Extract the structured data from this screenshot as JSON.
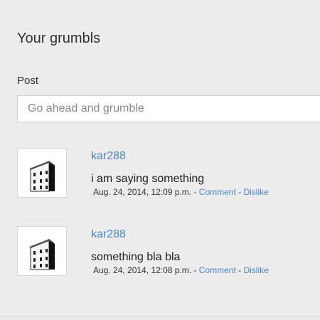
{
  "page": {
    "title": "Your grumbls"
  },
  "post": {
    "label": "Post",
    "placeholder": "Go ahead and grumble"
  },
  "grumbles": [
    {
      "author": "kar288",
      "text": "i am saying something",
      "timestamp": "Aug. 24, 2014, 12:09 p.m.",
      "separator1": " - ",
      "comment_label": "Comment",
      "separator2": " - ",
      "dislike_label": "Dislike",
      "avatar_icon": "building-icon"
    },
    {
      "author": "kar288",
      "text": "something bla bla",
      "timestamp": "Aug. 24, 2014, 12:08 p.m.",
      "separator1": " - ",
      "comment_label": "Comment",
      "separator2": " - ",
      "dislike_label": "Dislike",
      "avatar_icon": "building-icon"
    }
  ],
  "colors": {
    "link": "#4a86c8",
    "background": "#ececec"
  }
}
